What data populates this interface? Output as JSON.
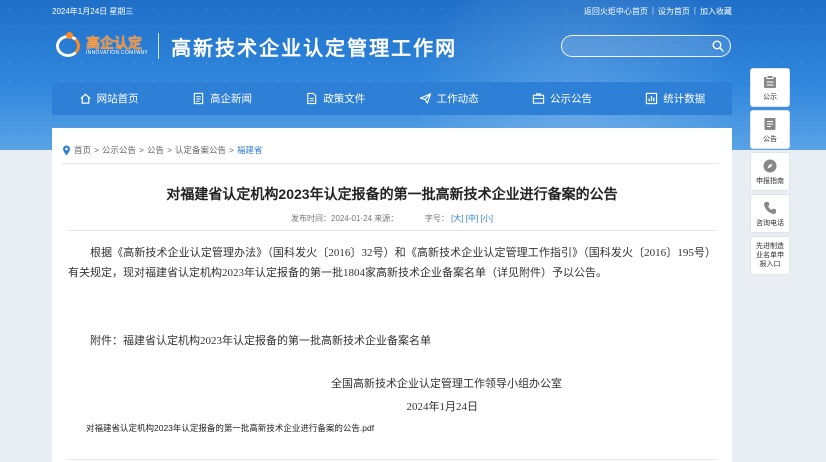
{
  "topbar": {
    "date": "2024年1月24日 星期三",
    "links": [
      "返回火炬中心首页",
      "设为首页",
      "加入收藏"
    ]
  },
  "logo": {
    "cn": "高企认定",
    "en": "INNOVATION COMPANY"
  },
  "site_title": "高新技术企业认定管理工作网",
  "search": {
    "placeholder": ""
  },
  "nav": {
    "items": [
      {
        "label": "网站首页",
        "icon": "home-icon"
      },
      {
        "label": "高企新闻",
        "icon": "news-icon"
      },
      {
        "label": "政策文件",
        "icon": "document-icon"
      },
      {
        "label": "工作动态",
        "icon": "send-icon"
      },
      {
        "label": "公示公告",
        "icon": "notice-icon"
      },
      {
        "label": "统计数据",
        "icon": "chart-icon"
      }
    ]
  },
  "breadcrumb": {
    "items": [
      "首页",
      "公示公告",
      "公告",
      "认定备案公告",
      "福建省"
    ],
    "separator": ">"
  },
  "article": {
    "title": "对福建省认定机构2023年认定报备的第一批高新技术企业进行备案的公告",
    "meta_date": "发布时间：2024-01-24 来源：",
    "meta_font": "字号：",
    "font_sizes": [
      "[大]",
      "[中]",
      "[小]"
    ],
    "body": "根据《高新技术企业认定管理办法》（国科发火〔2016〕32号）和《高新技术企业认定管理工作指引》（国科发火〔2016〕195号）有关规定，现对福建省认定机构2023年认定报备的第一批1804家高新技术企业备案名单（详见附件）予以公告。",
    "attachment_line": "附件：福建省认定机构2023年认定报备的第一批高新技术企业备案名单",
    "sign_org": "全国高新技术企业认定管理工作领导小组办公室",
    "sign_date": "2024年1月24日",
    "pdf_link": "对福建省认定机构2023年认定报备的第一批高新技术企业进行备案的公告.pdf"
  },
  "side": [
    {
      "label": "公示",
      "icon": "bulletin-icon"
    },
    {
      "label": "公告",
      "icon": "notice-board-icon"
    },
    {
      "label": "申报指南",
      "icon": "compass-icon"
    },
    {
      "label": "咨询电话",
      "icon": "phone-icon"
    },
    {
      "label": "先进制造业名单申报入口",
      "icon": ""
    }
  ],
  "colors": {
    "primary": "#2e7fd6",
    "accent": "#ff8a1f"
  }
}
